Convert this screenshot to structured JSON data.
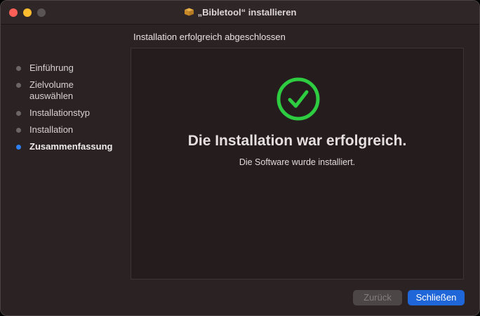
{
  "window": {
    "title": "„Bibletool“ installieren"
  },
  "sidebar": {
    "items": [
      {
        "label": "Einführung",
        "active": false
      },
      {
        "label": "Zielvolume auswählen",
        "active": false
      },
      {
        "label": "Installationstyp",
        "active": false
      },
      {
        "label": "Installation",
        "active": false
      },
      {
        "label": "Zusammenfassung",
        "active": true
      }
    ]
  },
  "main": {
    "heading": "Installation erfolgreich abgeschlossen",
    "success_title": "Die Installation war erfolgreich.",
    "success_subtitle": "Die Software wurde installiert."
  },
  "buttons": {
    "back_label": "Zurück",
    "close_label": "Schließen"
  },
  "colors": {
    "accent": "#1f66d8",
    "success": "#2ecc40",
    "active_step_dot": "#2f80f0"
  }
}
